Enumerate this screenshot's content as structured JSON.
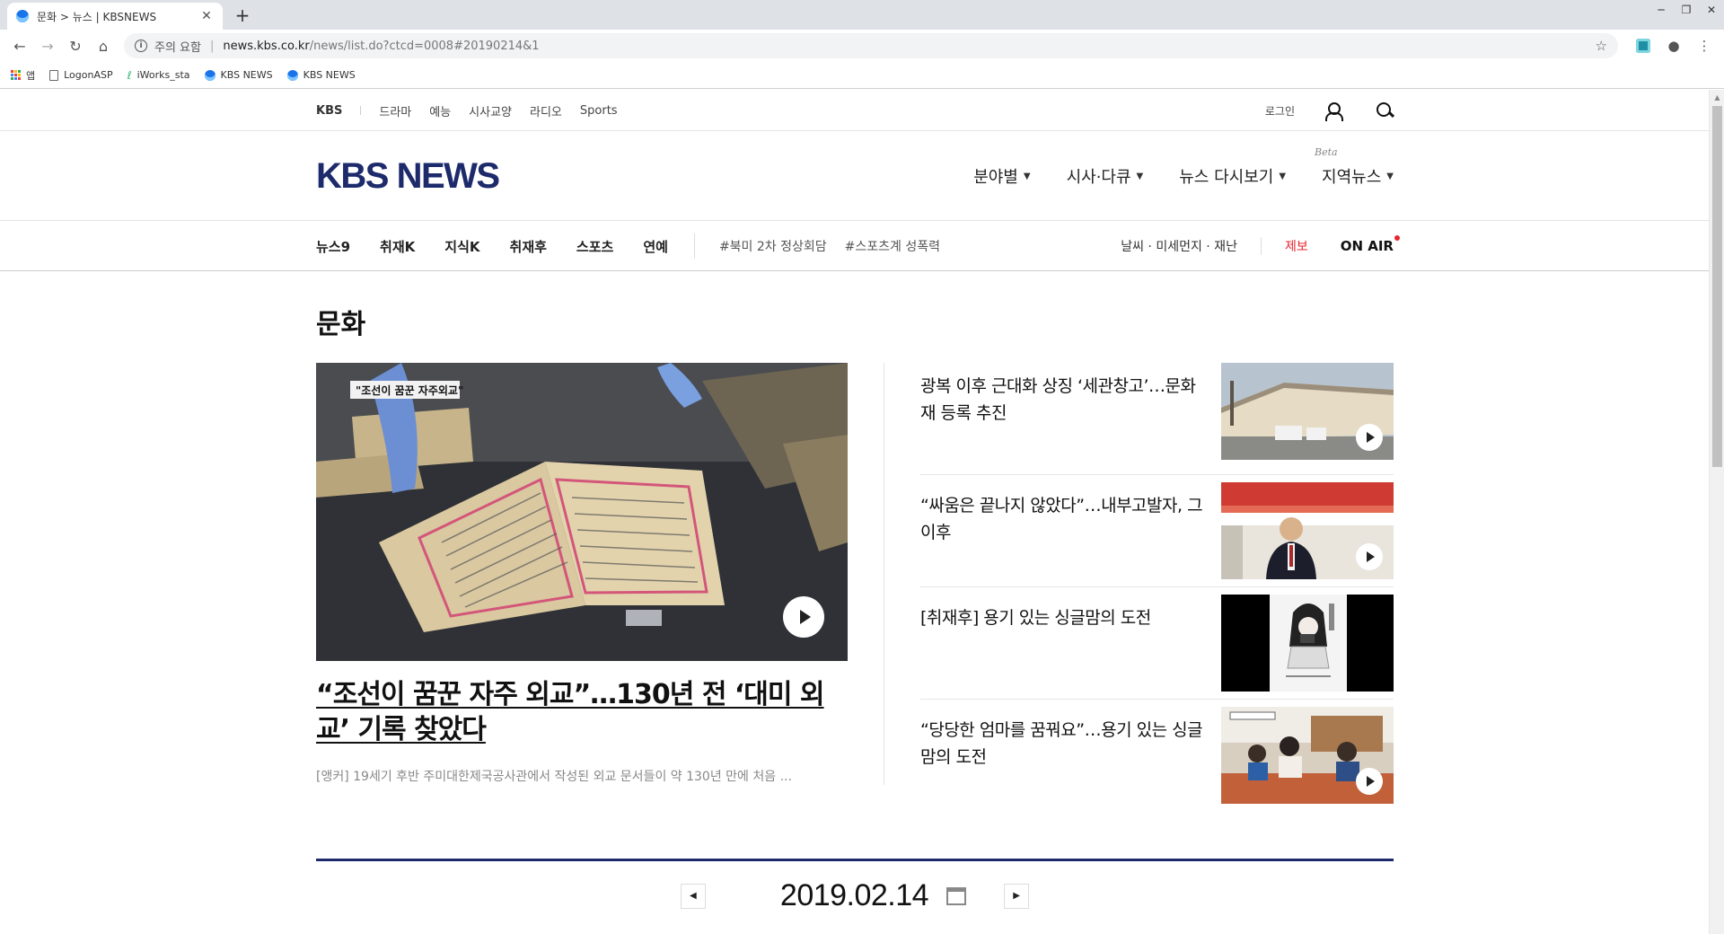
{
  "browser": {
    "tab_title": "문화 > 뉴스 | KBSNEWS",
    "url_warning": "주의 요함",
    "url_host": "news.kbs.co.kr",
    "url_path": "/news/list.do?ctcd=0008#20190214&1",
    "bookmarks": [
      {
        "label": "앱",
        "icon": "apps-icon"
      },
      {
        "label": "LogonASP",
        "icon": "document-icon"
      },
      {
        "label": "iWorks_sta",
        "icon": "leaf-icon"
      },
      {
        "label": "KBS NEWS",
        "icon": "globe-icon"
      },
      {
        "label": "KBS NEWS",
        "icon": "globe-icon"
      }
    ]
  },
  "gnb": {
    "kbs": "KBS",
    "services": [
      "드라마",
      "예능",
      "시사교양",
      "라디오",
      "Sports"
    ],
    "login": "로그인"
  },
  "header": {
    "logo": "KBS NEWS",
    "nav": [
      "분야별",
      "시사·다큐",
      "뉴스 다시보기",
      "지역뉴스"
    ],
    "beta": "Beta"
  },
  "subnav": {
    "programs": [
      "뉴스9",
      "취재K",
      "지식K",
      "취재후",
      "스포츠",
      "연예"
    ],
    "tags": [
      "#북미 2차 정상회담",
      "#스포츠계 성폭력"
    ],
    "weather": "날씨 · 미세먼지 · 재난",
    "report": "제보",
    "onair": "ON AIR"
  },
  "section": {
    "title": "문화"
  },
  "lead": {
    "caption": "\"조선이 꿈꾼 자주외교\"",
    "headline": "“조선이 꿈꾼 자주 외교”…130년 전 ‘대미 외교’ 기록 찾았다",
    "summary": "[앵커] 19세기 후반 주미대한제국공사관에서 작성된 외교 문서들이 약 130년 만에 처음 ..."
  },
  "articles": [
    {
      "title": "광복 이후 근대화 상징 ‘세관창고’…문화재 등록 추진"
    },
    {
      "title": "“싸움은 끝나지 않았다”…내부고발자, 그 이후"
    },
    {
      "title": "[취재후] 용기 있는 싱글맘의 도전"
    },
    {
      "title": "“당당한 엄마를 꿈꿔요”…용기 있는 싱글맘의 도전"
    }
  ],
  "date_nav": {
    "date": "2019.02.14"
  },
  "colors": {
    "brand": "#1d2a6b",
    "accent_red": "#e8242f"
  }
}
